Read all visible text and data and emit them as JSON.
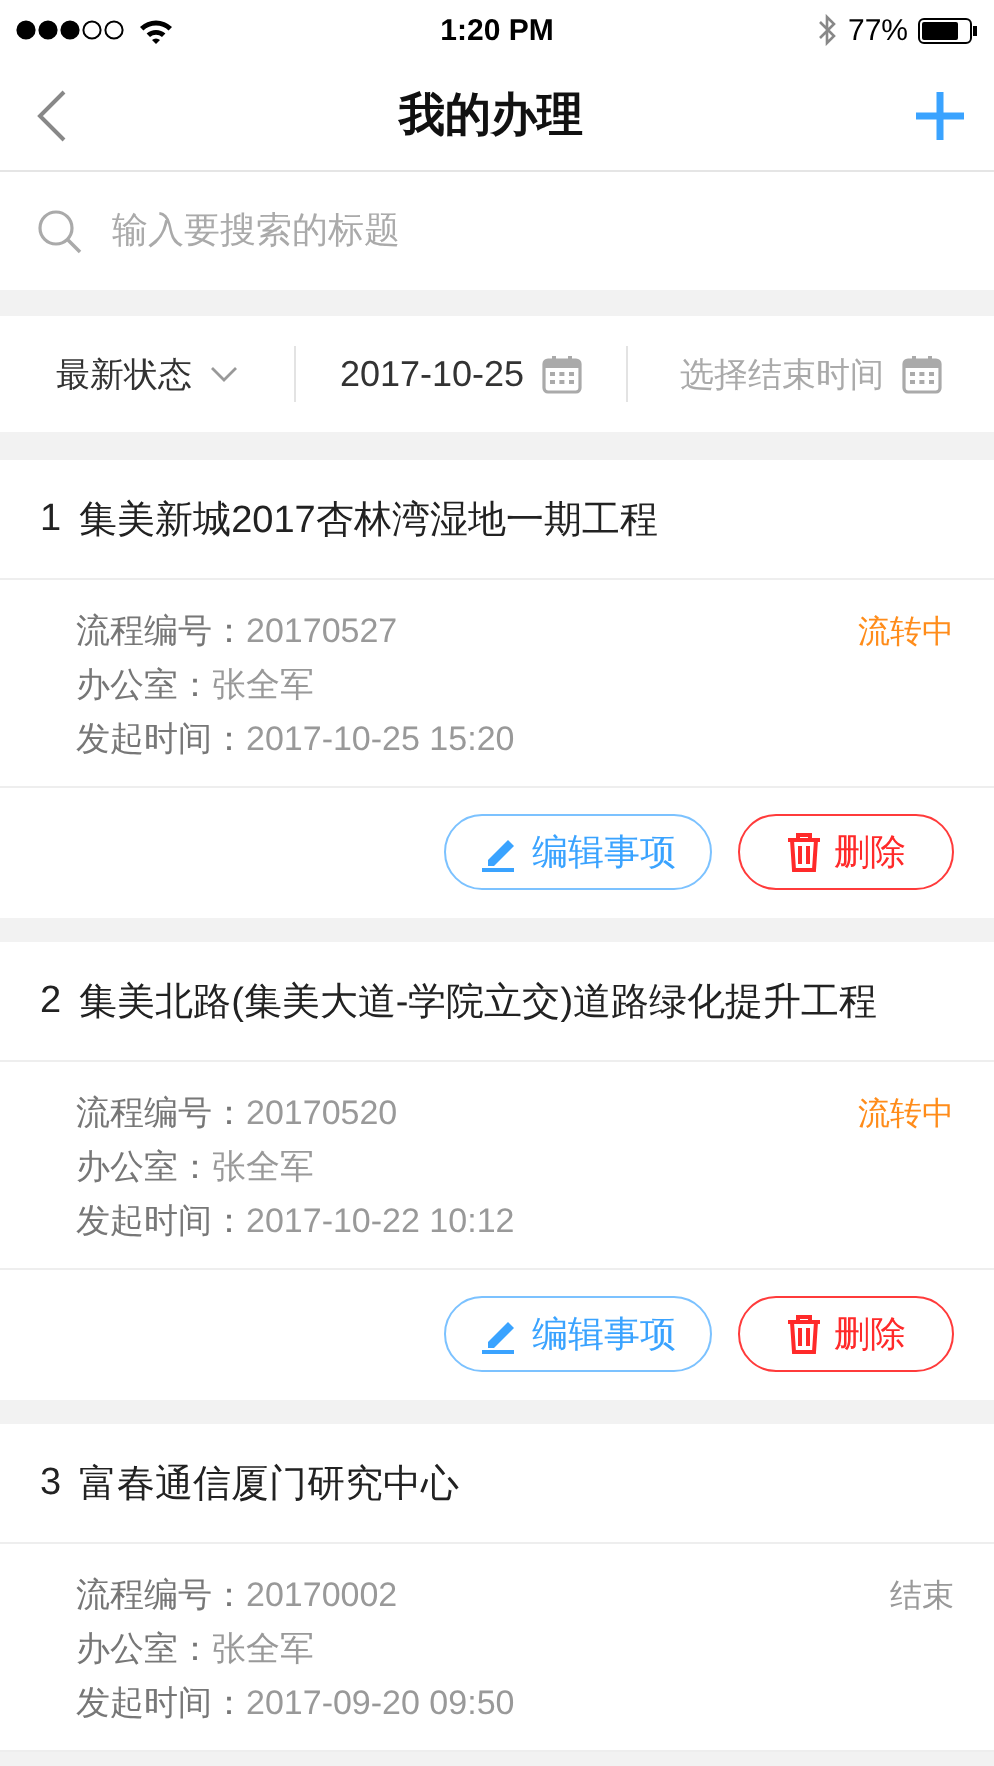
{
  "status_bar": {
    "time": "1:20 PM",
    "battery": "77%"
  },
  "nav": {
    "title": "我的办理"
  },
  "search": {
    "placeholder": "输入要搜索的标题"
  },
  "filters": {
    "status": "最新状态",
    "start_date": "2017-10-25",
    "end_placeholder": "选择结束时间"
  },
  "cards": [
    {
      "index": "1",
      "title": "集美新城2017杏林湾湿地一期工程",
      "status": {
        "text": "流转中",
        "color": "#ff8c1a"
      },
      "fields": [
        {
          "label": "流程编号：",
          "value": "20170527"
        },
        {
          "label": "办公室：",
          "value": "张全军"
        },
        {
          "label": "发起时间：",
          "value": "2017-10-25 15:20"
        }
      ],
      "buttons": [
        {
          "kind": "edit",
          "label": "编辑事项"
        },
        {
          "kind": "delete",
          "label": "删除"
        }
      ]
    },
    {
      "index": "2",
      "title": "集美北路(集美大道-学院立交)道路绿化提升工程",
      "status": {
        "text": "流转中",
        "color": "#ff8c1a"
      },
      "fields": [
        {
          "label": "流程编号：",
          "value": "20170520"
        },
        {
          "label": "办公室：",
          "value": "张全军"
        },
        {
          "label": "发起时间：",
          "value": "2017-10-22 10:12"
        }
      ],
      "buttons": [
        {
          "kind": "edit",
          "label": "编辑事项"
        },
        {
          "kind": "delete",
          "label": "删除"
        }
      ]
    },
    {
      "index": "3",
      "title": "富春通信厦门研究中心",
      "status": {
        "text": "结束",
        "color": "#999999"
      },
      "fields": [
        {
          "label": "流程编号：",
          "value": "20170002"
        },
        {
          "label": "办公室：",
          "value": "张全军"
        },
        {
          "label": "发起时间：",
          "value": "2017-09-20 09:50"
        }
      ]
    }
  ]
}
